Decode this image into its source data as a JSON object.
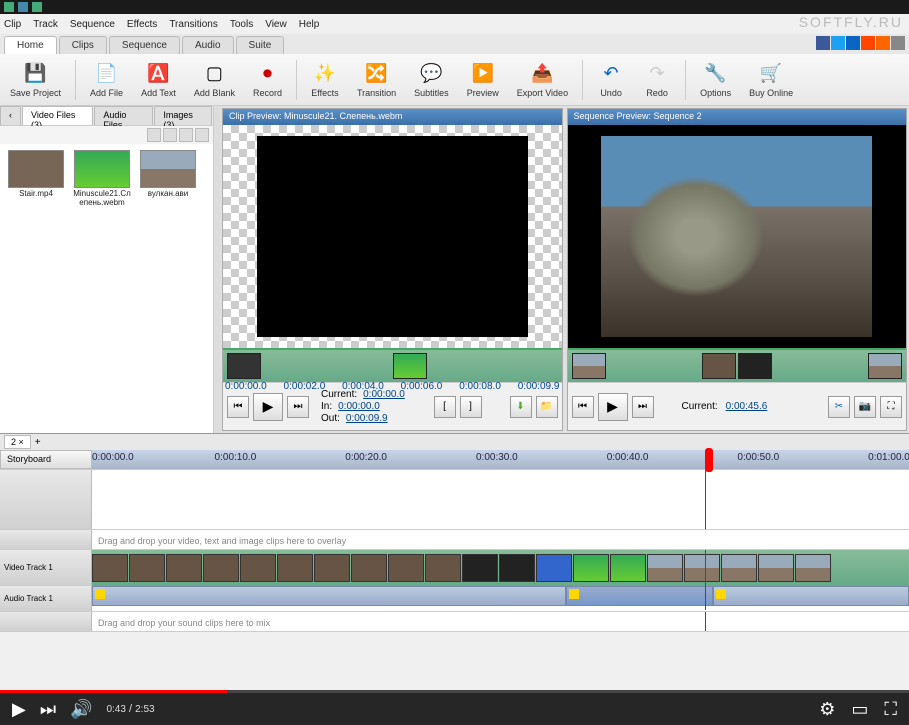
{
  "watermark": "SOFTFLY.RU",
  "menus": [
    "Clip",
    "Track",
    "Sequence",
    "Effects",
    "Transitions",
    "Tools",
    "View",
    "Help"
  ],
  "ribbonTabs": [
    "Home",
    "Clips",
    "Sequence",
    "Audio",
    "Suite"
  ],
  "ribbon": {
    "save": "Save Project",
    "addFile": "Add File",
    "addText": "Add Text",
    "addBlank": "Add Blank",
    "record": "Record",
    "effects": "Effects",
    "transition": "Transition",
    "subtitles": "Subtitles",
    "preview": "Preview",
    "export": "Export Video",
    "undo": "Undo",
    "redo": "Redo",
    "options": "Options",
    "buyOnline": "Buy Online"
  },
  "fileTabs": {
    "video": "Video Files (3)",
    "audio": "Audio Files",
    "images": "Images (3)"
  },
  "files": [
    {
      "name": "Stair.mp4"
    },
    {
      "name": "Minuscule21.Слепень.webm"
    },
    {
      "name": "вулкан.ави"
    }
  ],
  "clipPreview": {
    "title": "Clip Preview: Minuscule21. Слепень.webm",
    "timecodes": [
      "0:00:00.0",
      "0:00:02.0",
      "0:00:04.0",
      "0:00:06.0",
      "0:00:08.0",
      "0:00:09.9"
    ],
    "currentLabel": "Current:",
    "inLabel": "In:",
    "outLabel": "Out:",
    "current": "0:00:00.0",
    "in": "0:00:00.0",
    "out": "0:00:09.9"
  },
  "seqPreview": {
    "title": "Sequence Preview: Sequence 2",
    "currentLabel": "Current:",
    "current": "0:00:45.6"
  },
  "timeline": {
    "seqTab": "2 ×",
    "storyboard": "Storyboard",
    "ticks": [
      "0:00:00.0",
      "0:00:10.0",
      "0:00:20.0",
      "0:00:30.0",
      "0:00:40.0",
      "0:00:50.0",
      "0:01:00.0"
    ],
    "overlayHint": "Drag and drop your video, text and image clips here to overlay",
    "videoTrack": "Video Track 1",
    "audioTrack": "Audio Track 1",
    "audioHint": "Drag and drop your sound clips here to mix"
  },
  "player": {
    "current": "0:43",
    "duration": "2:53"
  }
}
